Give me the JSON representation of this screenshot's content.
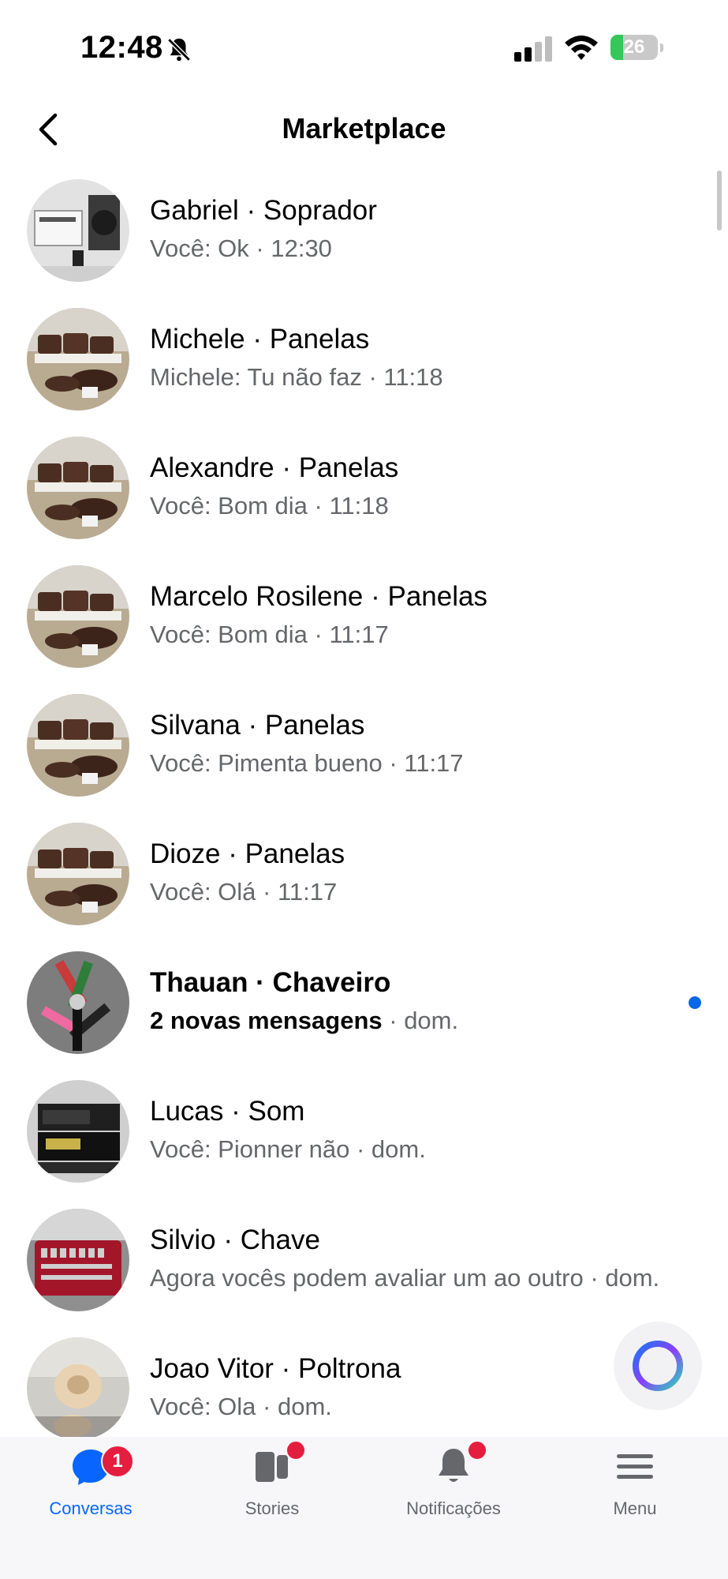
{
  "status_bar": {
    "time": "12:48",
    "battery_percent": "26",
    "battery_level": 0.26
  },
  "header": {
    "title": "Marketplace"
  },
  "conversations": [
    {
      "name": "Gabriel · Soprador",
      "preview": "Você: Ok",
      "time": " · 12:30",
      "unread": false,
      "thumb": "blower"
    },
    {
      "name": "Michele · Panelas",
      "preview": "Michele: Tu não faz",
      "time": " · 11:18",
      "unread": false,
      "thumb": "pans"
    },
    {
      "name": "Alexandre · Panelas",
      "preview": "Você: Bom dia",
      "time": " · 11:18",
      "unread": false,
      "thumb": "pans"
    },
    {
      "name": "Marcelo Rosilene · Panelas",
      "preview": "Você: Bom dia",
      "time": " · 11:17",
      "unread": false,
      "thumb": "pans"
    },
    {
      "name": "Silvana · Panelas",
      "preview": "Você: Pimenta bueno",
      "time": " · 11:17",
      "unread": false,
      "thumb": "pans"
    },
    {
      "name": "Dioze · Panelas",
      "preview": "Você: Olá",
      "time": " · 11:17",
      "unread": false,
      "thumb": "pans"
    },
    {
      "name": "Thauan · Chaveiro",
      "preview": "2 novas mensagens",
      "time": " · dom.",
      "unread": true,
      "thumb": "keychains"
    },
    {
      "name": "Lucas · Som",
      "preview": "Você: Pionner não",
      "time": " · dom.",
      "unread": false,
      "thumb": "stereo"
    },
    {
      "name": "Silvio · Chave",
      "preview": "Agora vocês podem avaliar um ao outro",
      "time": " · dom.",
      "unread": false,
      "thumb": "toolbox"
    },
    {
      "name": "Joao Vitor · Poltrona",
      "preview": "Você: Ola",
      "time": " · dom.",
      "unread": false,
      "thumb": "chair"
    }
  ],
  "tabs": [
    {
      "label": "Conversas",
      "active": true,
      "badge": "1",
      "icon": "chat-bubble-icon"
    },
    {
      "label": "Stories",
      "active": false,
      "icon": "stories-icon"
    },
    {
      "label": "Notificações",
      "active": false,
      "icon": "bell-icon"
    },
    {
      "label": "Menu",
      "active": false,
      "icon": "hamburger-menu-icon"
    }
  ],
  "colors": {
    "accent": "#0866ff",
    "badge": "#e41e3f",
    "unread_dot": "#0a66e8",
    "battery_fill": "#34c759"
  }
}
